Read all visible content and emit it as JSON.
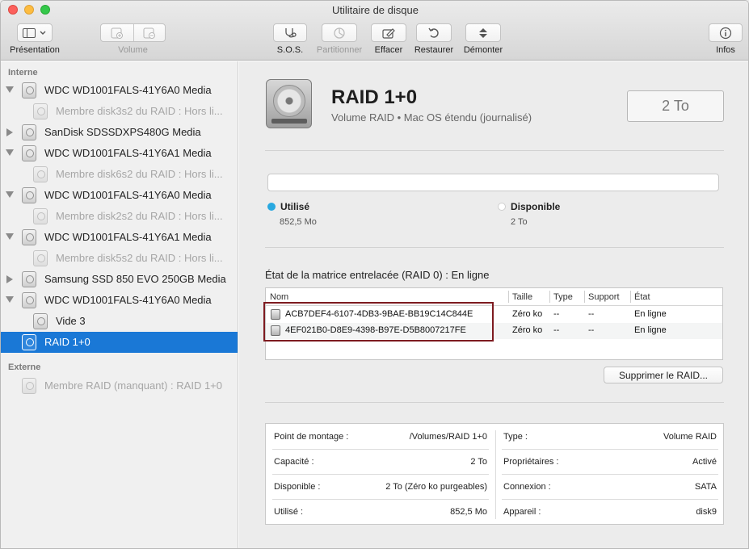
{
  "window": {
    "title": "Utilitaire de disque"
  },
  "toolbar": {
    "presentation_label": "Présentation",
    "volume_label": "Volume",
    "sos_label": "S.O.S.",
    "partition_label": "Partitionner",
    "erase_label": "Effacer",
    "restore_label": "Restaurer",
    "unmount_label": "Démonter",
    "info_label": "Infos"
  },
  "sidebar": {
    "internal_header": "Interne",
    "external_header": "Externe",
    "items": [
      {
        "label": "WDC WD1001FALS-41Y6A0 Media",
        "level": 0,
        "expanded": true,
        "selected": false,
        "faded": false
      },
      {
        "label": "Membre disk3s2 du RAID : Hors li...",
        "level": 1,
        "expanded": null,
        "selected": false,
        "faded": true
      },
      {
        "label": "SanDisk SDSSDXPS480G Media",
        "level": 0,
        "expanded": false,
        "selected": false,
        "faded": false
      },
      {
        "label": "WDC WD1001FALS-41Y6A1 Media",
        "level": 0,
        "expanded": true,
        "selected": false,
        "faded": false
      },
      {
        "label": "Membre disk6s2 du RAID : Hors li...",
        "level": 1,
        "expanded": null,
        "selected": false,
        "faded": true
      },
      {
        "label": "WDC WD1001FALS-41Y6A0 Media",
        "level": 0,
        "expanded": true,
        "selected": false,
        "faded": false
      },
      {
        "label": "Membre disk2s2 du RAID : Hors li...",
        "level": 1,
        "expanded": null,
        "selected": false,
        "faded": true
      },
      {
        "label": "WDC WD1001FALS-41Y6A1 Media",
        "level": 0,
        "expanded": true,
        "selected": false,
        "faded": false
      },
      {
        "label": "Membre disk5s2 du RAID : Hors li...",
        "level": 1,
        "expanded": null,
        "selected": false,
        "faded": true
      },
      {
        "label": "Samsung SSD 850 EVO 250GB Media",
        "level": 0,
        "expanded": false,
        "selected": false,
        "faded": false
      },
      {
        "label": "WDC WD1001FALS-41Y6A0 Media",
        "level": 0,
        "expanded": true,
        "selected": false,
        "faded": false
      },
      {
        "label": "Vide 3",
        "level": 1,
        "expanded": null,
        "selected": false,
        "faded": false
      },
      {
        "label": "RAID 1+0",
        "level": 0,
        "expanded": null,
        "selected": true,
        "faded": false
      }
    ],
    "external_items": [
      {
        "label": "Membre RAID (manquant) : RAID 1+0",
        "faded": true
      }
    ]
  },
  "volume": {
    "name": "RAID 1+0",
    "subtitle": "Volume RAID • Mac OS étendu (journalisé)",
    "capacity_badge": "2 To",
    "used_label": "Utilisé",
    "used_value": "852,5 Mo",
    "available_label": "Disponible",
    "available_value": "2 To",
    "used_color": "#28a8e0",
    "available_color": "#ffffff"
  },
  "raid": {
    "status_text": "État de la matrice entrelacée (RAID 0) : En ligne",
    "columns": [
      "Nom",
      "Taille",
      "Type",
      "Support",
      "État"
    ],
    "rows": [
      {
        "name": "ACB7DEF4-6107-4DB3-9BAE-BB19C14C844E",
        "size": "Zéro ko",
        "type": "--",
        "support": "--",
        "state": "En ligne"
      },
      {
        "name": "4EF021B0-D8E9-4398-B97E-D5B8007217FE",
        "size": "Zéro ko",
        "type": "--",
        "support": "--",
        "state": "En ligne"
      }
    ],
    "remove_button": "Supprimer le RAID..."
  },
  "info": {
    "left": [
      {
        "key": "Point de montage :",
        "value": "/Volumes/RAID 1+0"
      },
      {
        "key": "Capacité :",
        "value": "2 To"
      },
      {
        "key": "Disponible :",
        "value": "2 To (Zéro ko purgeables)"
      },
      {
        "key": "Utilisé :",
        "value": "852,5 Mo"
      }
    ],
    "right": [
      {
        "key": "Type :",
        "value": "Volume RAID"
      },
      {
        "key": "Propriétaires :",
        "value": "Activé"
      },
      {
        "key": "Connexion :",
        "value": "SATA"
      },
      {
        "key": "Appareil :",
        "value": "disk9"
      }
    ]
  }
}
